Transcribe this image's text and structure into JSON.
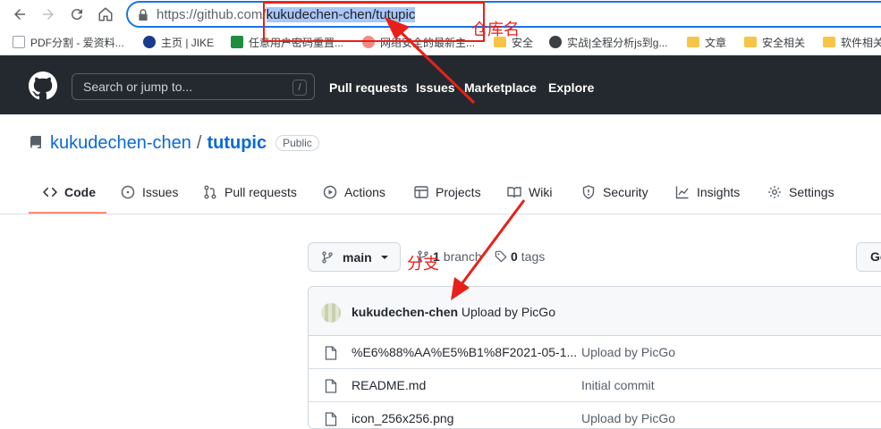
{
  "browser": {
    "url_prefix": "https://github.com/",
    "url_selected": "kukudechen-chen/tutupic",
    "bookmarks": [
      {
        "label": "PDF分割 - 爱资料...",
        "color": "#9aa0a6"
      },
      {
        "label": "主页 | JIKE",
        "color": "#1a3b8c"
      },
      {
        "label": "任意用户密码重置...",
        "color": "#1e8e3e"
      },
      {
        "label": "网络安全的最新主...",
        "color": "#f28b82"
      },
      {
        "label": "安全",
        "color": "#f6c548"
      },
      {
        "label": "实战|全程分析js到g...",
        "color": "#3c4043"
      },
      {
        "label": "文章",
        "color": "#f6c548"
      },
      {
        "label": "安全相关",
        "color": "#f6c548"
      },
      {
        "label": "软件相关",
        "color": "#f6c548"
      }
    ]
  },
  "header": {
    "search_placeholder": "Search or jump to...",
    "search_key": "/",
    "nav": [
      "Pull requests",
      "Issues",
      "Marketplace",
      "Explore"
    ]
  },
  "repo": {
    "owner": "kukudechen-chen",
    "separator": "/",
    "name": "tutupic",
    "visibility": "Public"
  },
  "tabs": [
    "Code",
    "Issues",
    "Pull requests",
    "Actions",
    "Projects",
    "Wiki",
    "Security",
    "Insights",
    "Settings"
  ],
  "branch_bar": {
    "branch": "main",
    "branch_count": "1",
    "branch_label": "branch",
    "tag_count": "0",
    "tag_label": "tags",
    "goto_label": "Go"
  },
  "commit": {
    "author": "kukudechen-chen",
    "message": "Upload by PicGo"
  },
  "files": [
    {
      "name": "%E6%88%AA%E5%B1%8F2021-05-1...",
      "message": "Upload by PicGo"
    },
    {
      "name": "README.md",
      "message": "Initial commit"
    },
    {
      "name": "icon_256x256.png",
      "message": "Upload by PicGo"
    }
  ],
  "annotations": {
    "repo_label": "仓库名",
    "branch_label": "分支",
    "color": "#e8201a"
  }
}
